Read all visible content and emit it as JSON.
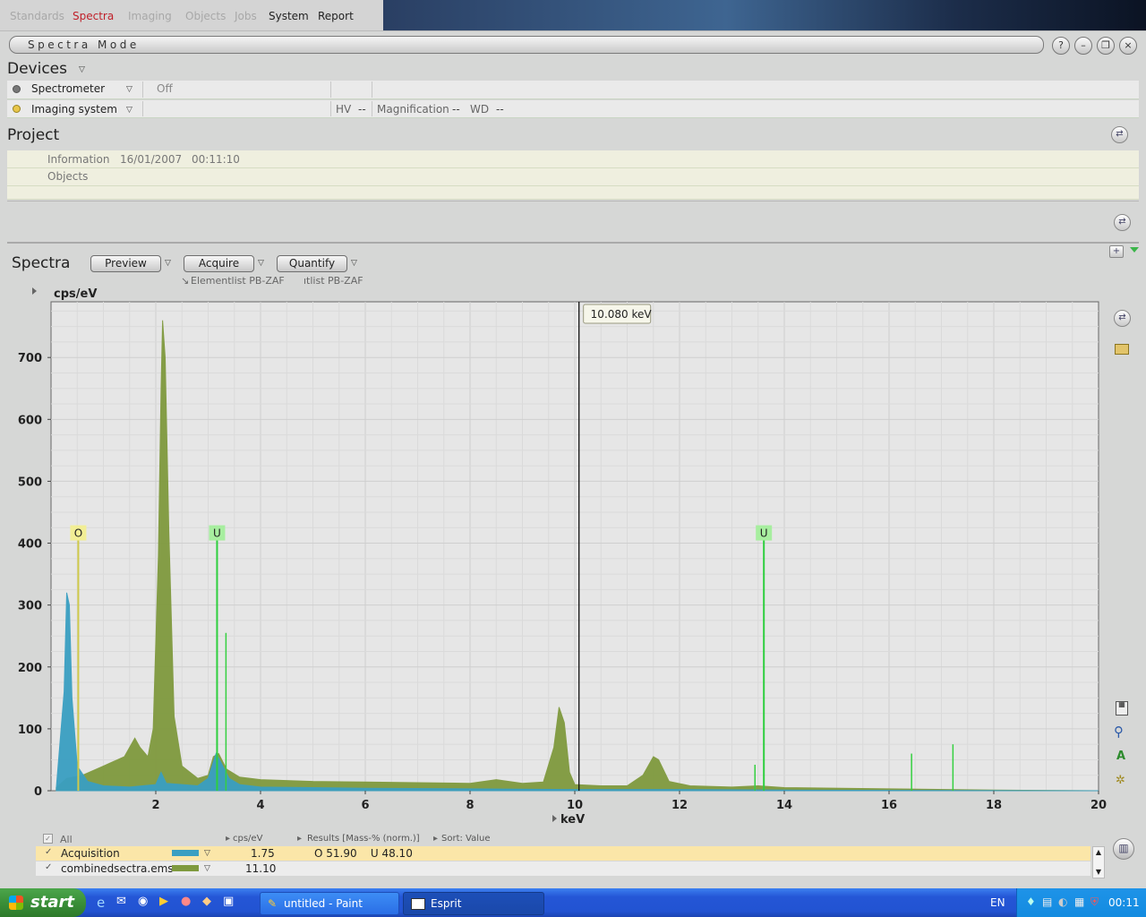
{
  "topmenu": {
    "items": [
      {
        "label": "Standards",
        "state": "dim"
      },
      {
        "label": "Spectra",
        "state": "active"
      },
      {
        "label": "Imaging",
        "state": "dim"
      },
      {
        "label": "Objects",
        "state": "dim"
      },
      {
        "label": "Jobs",
        "state": "dim"
      },
      {
        "label": "System",
        "state": "normal"
      },
      {
        "label": "Report",
        "state": "normal"
      }
    ]
  },
  "mode_title": "Spectra Mode",
  "window_buttons": {
    "help": "?",
    "minimize": "–",
    "restore": "❐",
    "close": "×"
  },
  "devices": {
    "title": "Devices",
    "spectrometer": {
      "label": "Spectrometer",
      "status": "Off"
    },
    "imaging": {
      "label": "Imaging system",
      "hv_label": "HV",
      "hv_value": "--",
      "mag_label": "Magnification",
      "mag_value": "--",
      "wd_label": "WD",
      "wd_value": "--"
    }
  },
  "project": {
    "title": "Project",
    "info_label": "Information",
    "info_date": "16/01/2007",
    "info_time": "00:11:10",
    "objects_label": "Objects"
  },
  "spectra": {
    "title": "Spectra",
    "preview": "Preview",
    "acquire": "Acquire",
    "quantify": "Quantify",
    "elementlist1": "Elementlist PB-ZAF",
    "elementlist2": "ıtlist PB-ZAF",
    "cursor_readout": "10.080 keV"
  },
  "chart_data": {
    "type": "line",
    "ylabel": "cps/eV",
    "xlabel": "keV",
    "xlim": [
      0,
      20
    ],
    "ylim": [
      0,
      790
    ],
    "x_ticks": [
      2,
      4,
      6,
      8,
      10,
      12,
      14,
      16,
      18,
      20
    ],
    "y_ticks": [
      0,
      100,
      200,
      300,
      400,
      500,
      600,
      700
    ],
    "cursor_kev": 10.08,
    "series": [
      {
        "name": "Acquisition",
        "color": "#3a9fc2",
        "points": [
          [
            0.1,
            5
          ],
          [
            0.25,
            160
          ],
          [
            0.3,
            320
          ],
          [
            0.35,
            300
          ],
          [
            0.4,
            150
          ],
          [
            0.5,
            40
          ],
          [
            0.7,
            15
          ],
          [
            1.0,
            8
          ],
          [
            1.5,
            6
          ],
          [
            2.0,
            10
          ],
          [
            2.1,
            30
          ],
          [
            2.2,
            12
          ],
          [
            2.8,
            8
          ],
          [
            3.0,
            20
          ],
          [
            3.15,
            60
          ],
          [
            3.25,
            45
          ],
          [
            3.4,
            20
          ],
          [
            3.6,
            10
          ],
          [
            4.0,
            6
          ],
          [
            6,
            4
          ],
          [
            8,
            3
          ],
          [
            10,
            2
          ],
          [
            12,
            2
          ],
          [
            14,
            1
          ],
          [
            20,
            0
          ]
        ]
      },
      {
        "name": "combinedsectra.ems",
        "color": "#7f9a3e",
        "points": [
          [
            0.1,
            5
          ],
          [
            0.3,
            20
          ],
          [
            0.6,
            25
          ],
          [
            1.0,
            40
          ],
          [
            1.4,
            55
          ],
          [
            1.6,
            85
          ],
          [
            1.7,
            70
          ],
          [
            1.85,
            55
          ],
          [
            1.95,
            100
          ],
          [
            2.05,
            380
          ],
          [
            2.1,
            650
          ],
          [
            2.13,
            760
          ],
          [
            2.18,
            700
          ],
          [
            2.25,
            420
          ],
          [
            2.35,
            120
          ],
          [
            2.5,
            40
          ],
          [
            2.8,
            20
          ],
          [
            3.0,
            25
          ],
          [
            3.1,
            55
          ],
          [
            3.2,
            60
          ],
          [
            3.35,
            35
          ],
          [
            3.6,
            22
          ],
          [
            4.0,
            18
          ],
          [
            5.0,
            15
          ],
          [
            6.0,
            14
          ],
          [
            7.0,
            13
          ],
          [
            8.0,
            12
          ],
          [
            8.5,
            18
          ],
          [
            9.0,
            12
          ],
          [
            9.4,
            14
          ],
          [
            9.6,
            70
          ],
          [
            9.7,
            135
          ],
          [
            9.8,
            110
          ],
          [
            9.9,
            30
          ],
          [
            10.0,
            10
          ],
          [
            10.5,
            8
          ],
          [
            11.0,
            8
          ],
          [
            11.3,
            25
          ],
          [
            11.5,
            55
          ],
          [
            11.6,
            50
          ],
          [
            11.8,
            15
          ],
          [
            12.2,
            8
          ],
          [
            13.0,
            6
          ],
          [
            13.5,
            8
          ],
          [
            14.0,
            5
          ],
          [
            16.0,
            3
          ],
          [
            18.0,
            1
          ],
          [
            20.0,
            0
          ]
        ]
      }
    ],
    "element_markers": [
      {
        "label": "O",
        "kev": 0.52,
        "height": 400,
        "color": "#cfc94a",
        "tag_color": "#f2ee95"
      },
      {
        "label": "U",
        "kev": 3.17,
        "height": 400,
        "color": "#2ecf3e",
        "tag_color": "#a7ee9f"
      },
      {
        "label": "U",
        "kev": 13.61,
        "height": 400,
        "color": "#2ecf3e",
        "tag_color": "#a7ee9f"
      }
    ],
    "line_marks": [
      {
        "kev": 3.34,
        "height": 255
      },
      {
        "kev": 13.44,
        "height": 42
      },
      {
        "kev": 16.43,
        "height": 60
      },
      {
        "kev": 17.22,
        "height": 75
      }
    ]
  },
  "results": {
    "all_label": "All",
    "col_cps": "cps/eV",
    "col_results": "Results [Mass-% (norm.)]",
    "col_sort": "Sort: Value",
    "rows": [
      {
        "name": "Acquisition",
        "color": "#3a9fc2",
        "cps": "1.75",
        "result": "O 51.90    U 48.10"
      },
      {
        "name": "combinedsectra.ems",
        "color": "#7f9a3e",
        "cps": "11.10",
        "result": ""
      }
    ]
  },
  "taskbar": {
    "start": "start",
    "tasks": [
      "untitled - Paint",
      "Esprit"
    ],
    "lang": "EN",
    "clock": "00:11"
  }
}
